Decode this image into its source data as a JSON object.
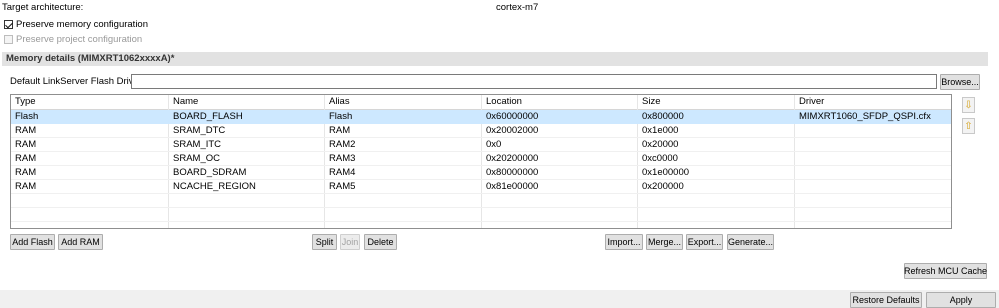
{
  "target": {
    "label": "Target architecture:",
    "value": "cortex-m7"
  },
  "preserve_memory": {
    "label": "Preserve memory configuration",
    "checked": true
  },
  "preserve_project": {
    "label": "Preserve project configuration",
    "checked": false,
    "disabled": true
  },
  "memory_section": {
    "title": "Memory details (MIMXRT1062xxxxA)*"
  },
  "flash_driver": {
    "label": "Default LinkServer Flash Driver",
    "value": "",
    "browse_label": "Browse..."
  },
  "table": {
    "columns": [
      "Type",
      "Name",
      "Alias",
      "Location",
      "Size",
      "Driver"
    ],
    "rows": [
      {
        "type": "Flash",
        "name": "BOARD_FLASH",
        "alias": "Flash",
        "location": "0x60000000",
        "size": "0x800000",
        "driver": "MIMXRT1060_SFDP_QSPI.cfx"
      },
      {
        "type": "RAM",
        "name": "SRAM_DTC",
        "alias": "RAM",
        "location": "0x20002000",
        "size": "0x1e000",
        "driver": ""
      },
      {
        "type": "RAM",
        "name": "SRAM_ITC",
        "alias": "RAM2",
        "location": "0x0",
        "size": "0x20000",
        "driver": ""
      },
      {
        "type": "RAM",
        "name": "SRAM_OC",
        "alias": "RAM3",
        "location": "0x20200000",
        "size": "0xc0000",
        "driver": ""
      },
      {
        "type": "RAM",
        "name": "BOARD_SDRAM",
        "alias": "RAM4",
        "location": "0x80000000",
        "size": "0x1e00000",
        "driver": ""
      },
      {
        "type": "RAM",
        "name": "NCACHE_REGION",
        "alias": "RAM5",
        "location": "0x81e00000",
        "size": "0x200000",
        "driver": ""
      }
    ],
    "selected_row": 0
  },
  "side_buttons": {
    "move_down_icon": "arrow-down-icon",
    "move_up_icon": "arrow-up-icon"
  },
  "buttons": {
    "add_flash": "Add Flash",
    "add_ram": "Add RAM",
    "split": "Split",
    "join": "Join",
    "delete": "Delete",
    "import": "Import...",
    "merge": "Merge...",
    "export": "Export...",
    "generate": "Generate...",
    "refresh_cache": "Refresh MCU Cache",
    "restore_defaults": "Restore Defaults",
    "apply": "Apply"
  }
}
